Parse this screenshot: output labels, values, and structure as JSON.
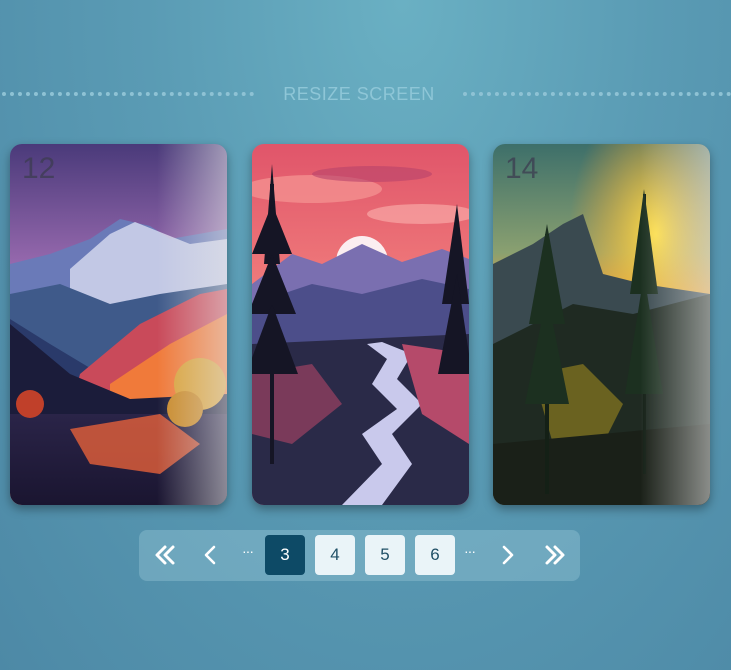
{
  "header": {
    "title": "RESIZE SCREEN"
  },
  "cards": [
    {
      "number": "12",
      "scene": "mountain-lake-sunset"
    },
    {
      "number": "",
      "scene": "river-valley-sunset"
    },
    {
      "number": "14",
      "scene": "forest-canyon-sunset"
    }
  ],
  "pagination": {
    "first_icon": "double-chevron-left-icon",
    "prev_icon": "chevron-left-icon",
    "ellipsis_left": "···",
    "pages": [
      "3",
      "4",
      "5",
      "6"
    ],
    "active_page": "3",
    "ellipsis_right": "···",
    "next_icon": "chevron-right-icon",
    "last_icon": "double-chevron-right-icon"
  },
  "colors": {
    "background": "#5a9bb4",
    "active_page": "#0d4a66",
    "page_box": "#eaf4f8"
  }
}
